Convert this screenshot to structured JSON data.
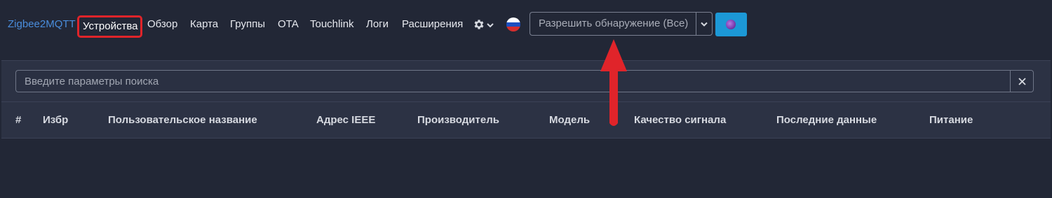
{
  "navbar": {
    "brand": "Zigbee2MQTT",
    "links": [
      {
        "label": "Устройства",
        "active": true
      },
      {
        "label": "Обзор"
      },
      {
        "label": "Карта"
      },
      {
        "label": "Группы"
      },
      {
        "label": "OTA"
      },
      {
        "label": "Touchlink"
      },
      {
        "label": "Логи"
      },
      {
        "label": "Расширения"
      }
    ],
    "settings_icon": "gear-icon",
    "language_icon": "russian-flag-icon",
    "permit_join_label": "Разрешить обнаружение (Все)",
    "permit_toggle_icon": "chevron-down-icon",
    "connection_icon": "connection-status-dot-icon"
  },
  "search": {
    "placeholder": "Введите параметры поиска",
    "clear_icon": "close-icon"
  },
  "table": {
    "headers": [
      "#",
      "Избр",
      "Пользовательское название",
      "Адрес IEEE",
      "Производитель",
      "Модель",
      "Качество сигнала",
      "Последние данные",
      "Питание"
    ]
  },
  "annotation": {
    "highlight_color": "#e0242a",
    "arrow_color": "#e0242a"
  }
}
